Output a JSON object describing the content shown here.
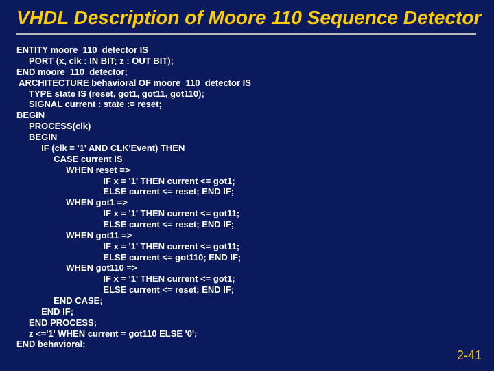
{
  "title": "VHDL Description of Moore 110 Sequence Detector",
  "code_lines": [
    "ENTITY moore_110_detector IS",
    "     PORT (x, clk : IN BIT; z : OUT BIT);",
    "END moore_110_detector;",
    " ARCHITECTURE behavioral OF moore_110_detector IS",
    "     TYPE state IS (reset, got1, got11, got110);",
    "     SIGNAL current : state := reset;",
    "BEGIN",
    "     PROCESS(clk)",
    "     BEGIN",
    "          IF (clk = '1' AND CLK'Event) THEN",
    "               CASE current IS",
    "                    WHEN reset =>",
    "                                   IF x = '1' THEN current <= got1;",
    "                                   ELSE current <= reset; END IF;",
    "                    WHEN got1 =>",
    "                                   IF x = '1' THEN current <= got11;",
    "                                   ELSE current <= reset; END IF;",
    "                    WHEN got11 =>",
    "                                   IF x = '1' THEN current <= got11;",
    "                                   ELSE current <= got110; END IF;",
    "                    WHEN got110 =>",
    "                                   IF x = '1' THEN current <= got1;",
    "                                   ELSE current <= reset; END IF;",
    "               END CASE;",
    "          END IF;",
    "     END PROCESS;",
    "     z <='1' WHEN current = got110 ELSE '0';",
    "END behavioral;"
  ],
  "page_number": "2-41"
}
